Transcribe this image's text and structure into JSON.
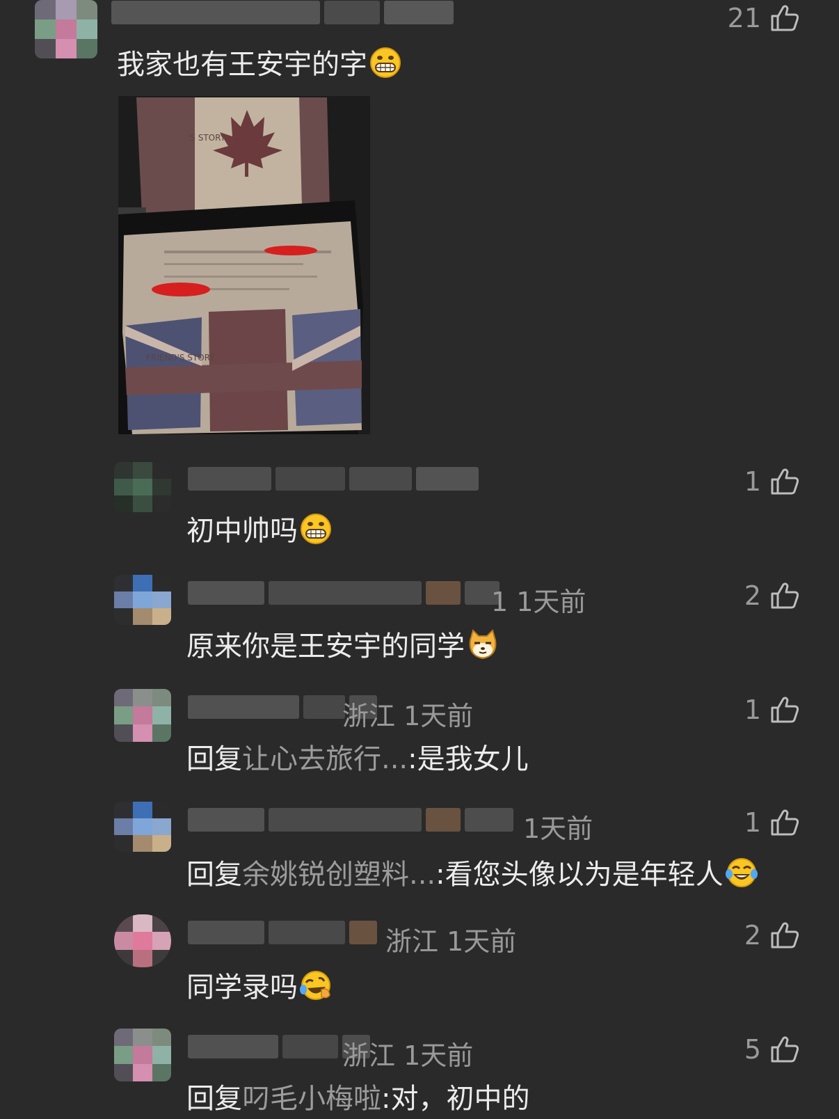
{
  "comments": [
    {
      "text": "我家也有王安宇的字",
      "likes": "21",
      "emoji": "grin-emoji"
    },
    {
      "text": "初中帅吗",
      "likes": "1",
      "emoji": "grin-emoji"
    },
    {
      "meta": "1 1天前",
      "text": "原来你是王安宇的同学",
      "likes": "2",
      "emoji": "cat-doge-emoji"
    },
    {
      "meta": "浙江 1天前",
      "reply_prefix": "回复",
      "reply_to": "让心去旅行...",
      "text": ":是我女儿",
      "likes": "1"
    },
    {
      "meta": "1天前",
      "reply_prefix": "回复",
      "reply_to": "余姚锐创塑料...",
      "text": ":看您头像以为是年轻人",
      "likes": "1",
      "emoji": "tears-of-joy-emoji"
    },
    {
      "meta": "浙江 1天前",
      "text": "同学录吗",
      "likes": "2",
      "emoji": "rofl-emoji"
    },
    {
      "meta": "浙江 1天前",
      "reply_prefix": "回复",
      "reply_to": "叼毛小梅啦",
      "text": ":对，初中的",
      "likes": "5"
    }
  ],
  "photo": {
    "label_top": "'S STORY",
    "label_bottom": "FRIEND'S STORY"
  }
}
